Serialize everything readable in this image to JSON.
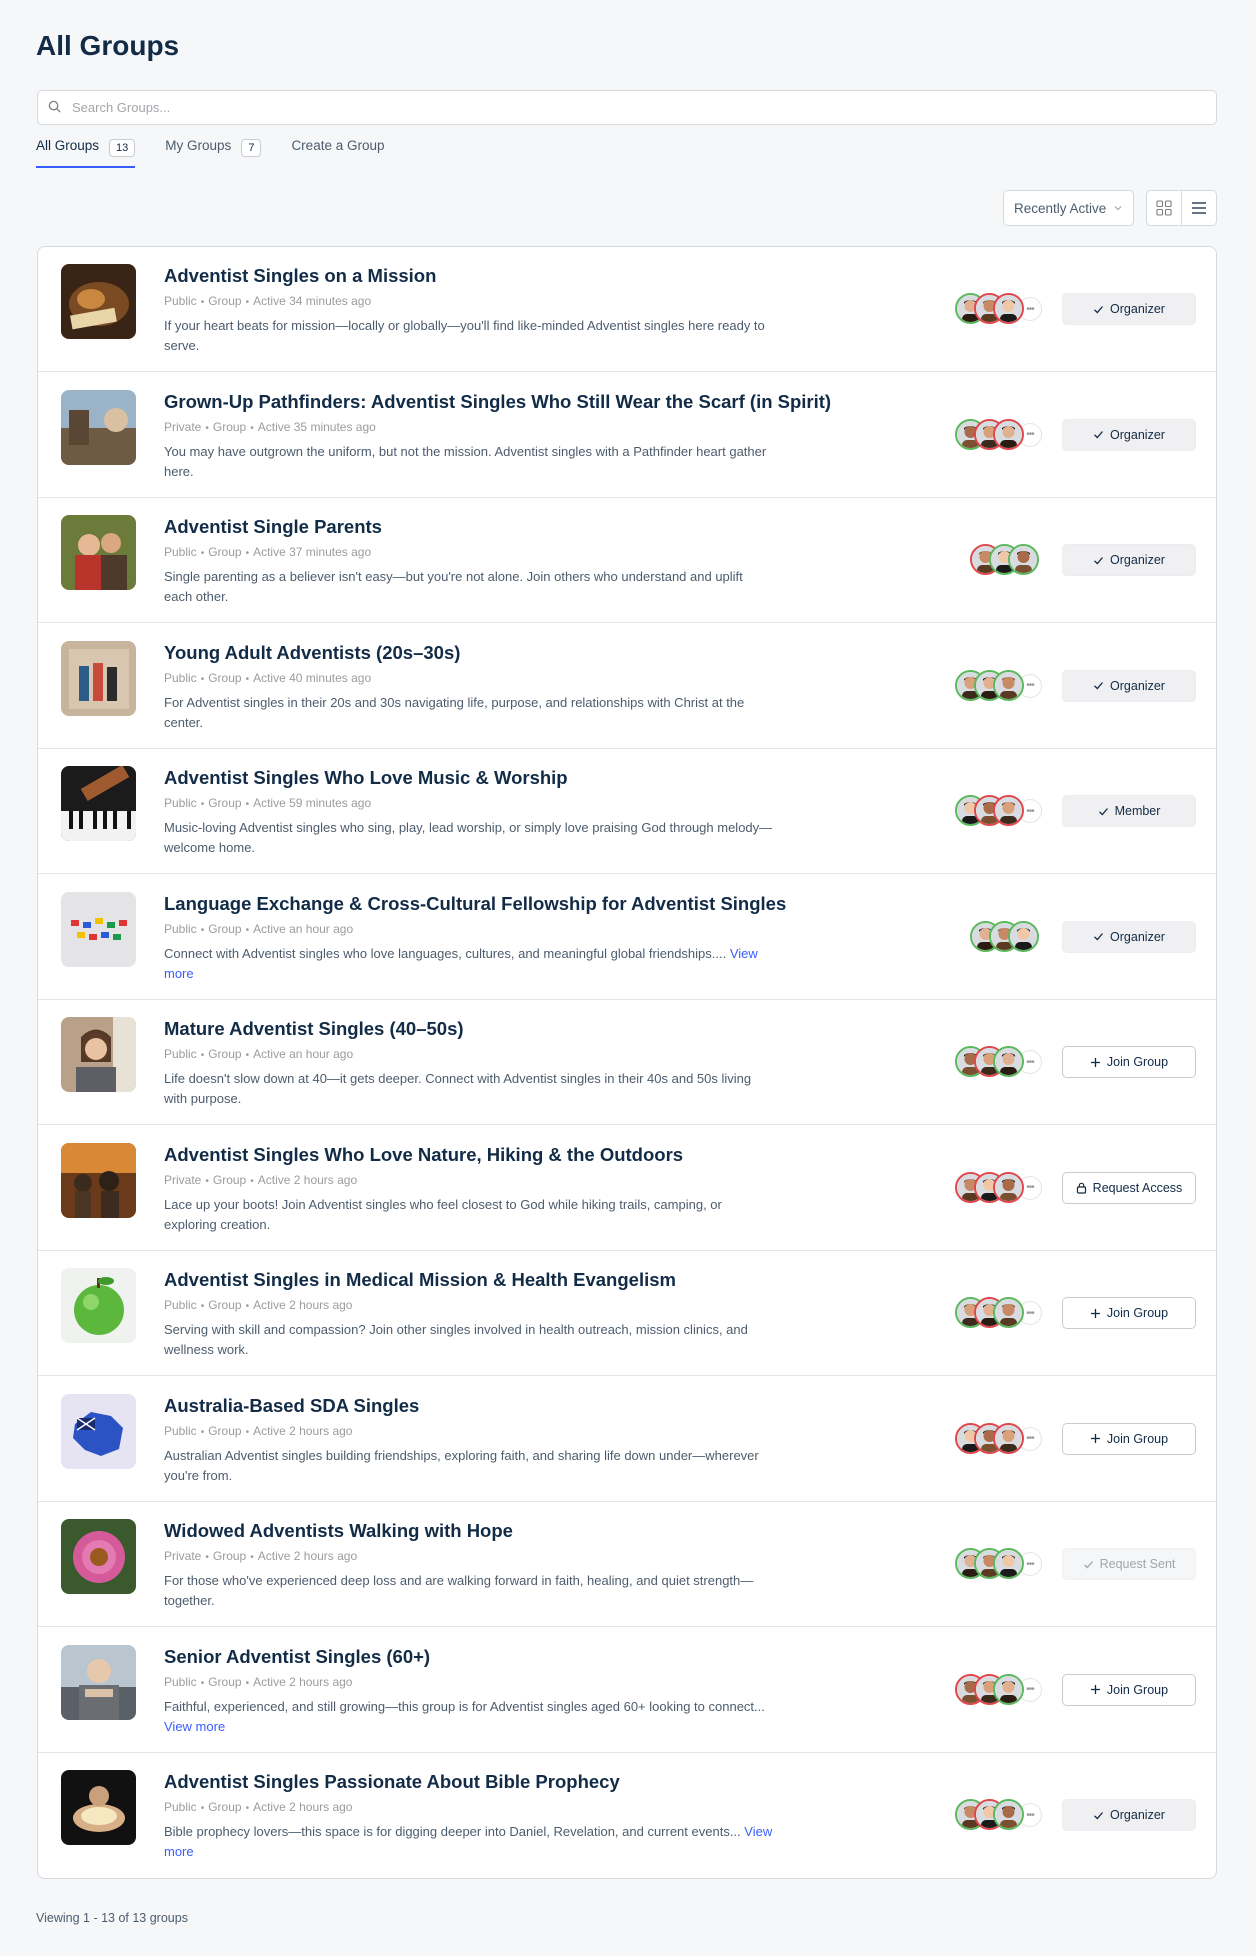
{
  "page_title": "All Groups",
  "search": {
    "placeholder": "Search Groups..."
  },
  "tabs": [
    {
      "label": "All Groups",
      "count": "13"
    },
    {
      "label": "My Groups",
      "count": "7"
    },
    {
      "label": "Create a Group"
    }
  ],
  "sort": {
    "selected": "Recently Active"
  },
  "view_modes": [
    "grid-icon",
    "list-icon"
  ],
  "groups": [
    {
      "name": "Adventist Singles on a Mission",
      "privacy": "Public",
      "type": "Group",
      "activity": "Active 34 minutes ago",
      "description": "If your heart beats for mission—locally or globally—you'll find like-minded Adventist singles here ready to serve.",
      "view_more": "",
      "action": "Organizer",
      "action_style": "organizer"
    },
    {
      "name": "Grown-Up Pathfinders: Adventist Singles Who Still Wear the Scarf (in Spirit)",
      "privacy": "Private",
      "type": "Group",
      "activity": "Active 35 minutes ago",
      "description": "You may have outgrown the uniform, but not the mission. Adventist singles with a Pathfinder heart gather here.",
      "view_more": "",
      "action": "Organizer",
      "action_style": "organizer"
    },
    {
      "name": "Adventist Single Parents",
      "privacy": "Public",
      "type": "Group",
      "activity": "Active 37 minutes ago",
      "description": "Single parenting as a believer isn't easy—but you're not alone. Join others who understand and uplift each other.",
      "view_more": "",
      "action": "Organizer",
      "action_style": "organizer"
    },
    {
      "name": "Young Adult Adventists (20s–30s)",
      "privacy": "Public",
      "type": "Group",
      "activity": "Active 40 minutes ago",
      "description": "For Adventist singles in their 20s and 30s navigating life, purpose, and relationships with Christ at the center.",
      "view_more": "",
      "action": "Organizer",
      "action_style": "organizer"
    },
    {
      "name": "Adventist Singles Who Love Music & Worship",
      "privacy": "Public",
      "type": "Group",
      "activity": "Active 59 minutes ago",
      "description": "Music-loving Adventist singles who sing, play, lead worship, or simply love praising God through melody—welcome home.",
      "view_more": "",
      "action": "Member",
      "action_style": "organizer"
    },
    {
      "name": "Language Exchange & Cross-Cultural Fellowship for Adventist Singles",
      "privacy": "Public",
      "type": "Group",
      "activity": "Active an hour ago",
      "description": "Connect with Adventist singles who love languages, cultures, and meaningful global friendships....",
      "view_more": "View more",
      "action": "Organizer",
      "action_style": "organizer"
    },
    {
      "name": "Mature Adventist Singles (40–50s)",
      "privacy": "Public",
      "type": "Group",
      "activity": "Active an hour ago",
      "description": "Life doesn't slow down at 40—it gets deeper. Connect with Adventist singles in their 40s and 50s living with purpose.",
      "view_more": "",
      "action": "Join Group",
      "action_style": "join"
    },
    {
      "name": "Adventist Singles Who Love Nature, Hiking & the Outdoors",
      "privacy": "Private",
      "type": "Group",
      "activity": "Active 2 hours ago",
      "description": "Lace up your boots! Join Adventist singles who feel closest to God while hiking trails, camping, or exploring creation.",
      "view_more": "",
      "action": "Request Access",
      "action_style": "request"
    },
    {
      "name": "Adventist Singles in Medical Mission & Health Evangelism",
      "privacy": "Public",
      "type": "Group",
      "activity": "Active 2 hours ago",
      "description": "Serving with skill and compassion? Join other singles involved in health outreach, mission clinics, and wellness work.",
      "view_more": "",
      "action": "Join Group",
      "action_style": "join"
    },
    {
      "name": "Australia-Based SDA Singles",
      "privacy": "Public",
      "type": "Group",
      "activity": "Active 2 hours ago",
      "description": "Australian Adventist singles building friendships, exploring faith, and sharing life down under—wherever you're from.",
      "view_more": "",
      "action": "Join Group",
      "action_style": "join"
    },
    {
      "name": "Widowed Adventists Walking with Hope",
      "privacy": "Private",
      "type": "Group",
      "activity": "Active 2 hours ago",
      "description": "For those who've experienced deep loss and are walking forward in faith, healing, and quiet strength—together.",
      "view_more": "",
      "action": "Request Sent",
      "action_style": "sent"
    },
    {
      "name": "Senior Adventist Singles (60+)",
      "privacy": "Public",
      "type": "Group",
      "activity": "Active 2 hours ago",
      "description": "Faithful, experienced, and still growing—this group is for Adventist singles aged 60+ looking to connect...",
      "view_more": "View more",
      "action": "Join Group",
      "action_style": "join"
    },
    {
      "name": "Adventist Singles Passionate About Bible Prophecy",
      "privacy": "Public",
      "type": "Group",
      "activity": "Active 2 hours ago",
      "description": "Bible prophecy lovers—this space is for digging deeper into Daniel, Revelation, and current events...",
      "view_more": "View more",
      "action": "Organizer",
      "action_style": "organizer"
    }
  ],
  "footer": "Viewing 1 - 13 of 13 groups",
  "colors": {
    "accent": "#385dff",
    "title": "#122b46",
    "avatar_ring_green": "#5bb85d",
    "avatar_ring_red": "#e0474c"
  }
}
